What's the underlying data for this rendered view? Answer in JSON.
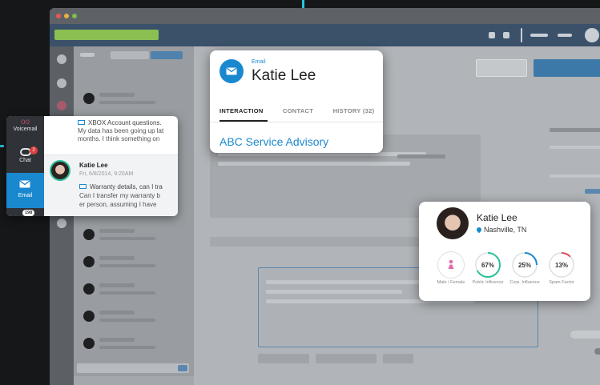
{
  "colors": {
    "accent": "#1a88cf",
    "cyan": "#26c6e0",
    "navbar": "#3a5169",
    "green": "#8cbf52"
  },
  "channel_rail": {
    "voicemail_label": "Voicemail",
    "chat_label": "Chat",
    "chat_badge": "2",
    "email_label": "Email",
    "email_count": "198"
  },
  "messages": [
    {
      "subject": "XBOX Account questions.",
      "preview1": "My data has been going up lat",
      "preview2": "months. I think something on"
    },
    {
      "name": "Katie Lee",
      "date": "Fri, 6/8/2014, 9:20AM",
      "subject": "Warranty details, can I tra",
      "preview1": "Can I transfer my warranty b",
      "preview2": "er person, assuming I have"
    }
  ],
  "contact_card": {
    "channel": "Email",
    "name": "Katie Lee",
    "tabs": [
      "INTERACTION",
      "CONTACT",
      "HISTORY (32)"
    ],
    "advisory": "ABC Service Advisory"
  },
  "profile_card": {
    "name": "Katie Lee",
    "location": "Nashville, TN",
    "metrics": [
      {
        "value": "",
        "label": "Male / Female",
        "icon": "female-icon"
      },
      {
        "value": "67%",
        "label": "Public Influence",
        "pct": 0.67,
        "color": "#2bbf9a"
      },
      {
        "value": "25%",
        "label": "Corp. Influence",
        "pct": 0.25,
        "color": "#1a88cf"
      },
      {
        "value": "13%",
        "label": "Spam Factor",
        "pct": 0.13,
        "color": "#e0455a"
      }
    ]
  }
}
